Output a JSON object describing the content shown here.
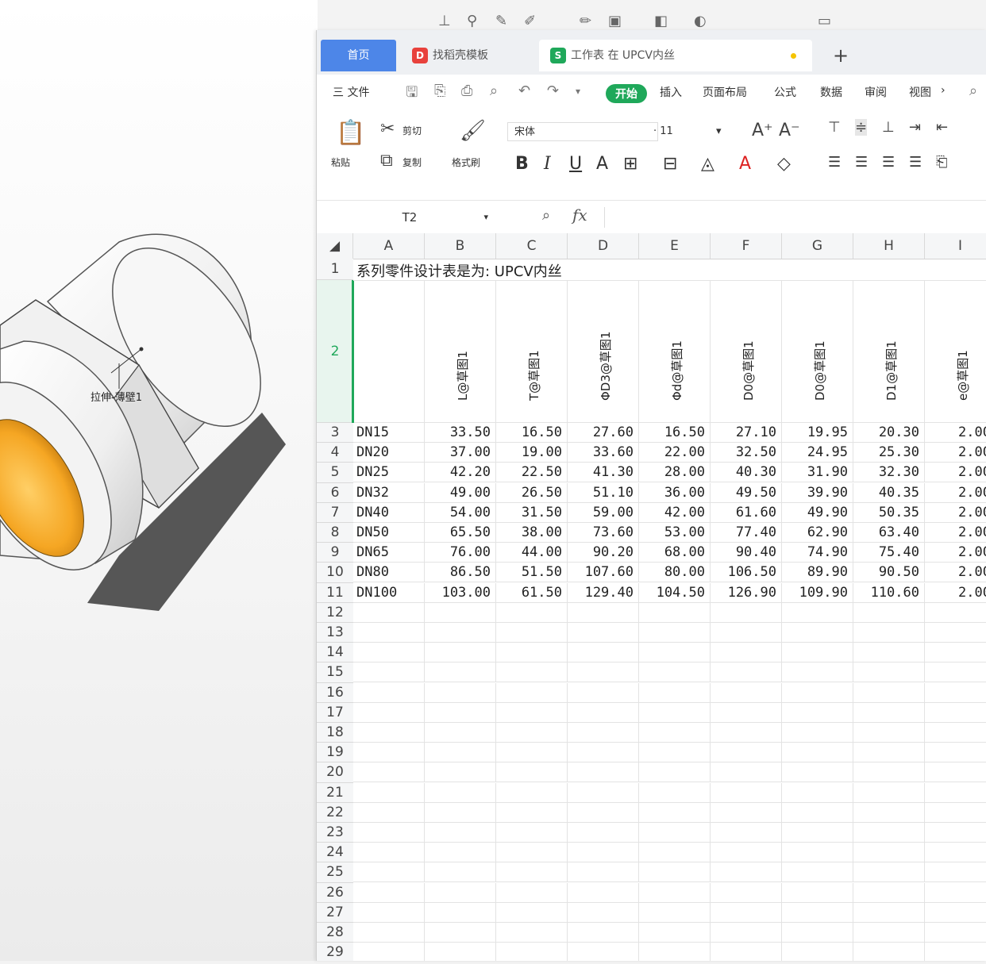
{
  "excel": {
    "tabs": [
      {
        "label": "首页"
      },
      {
        "label": "找稻壳模板"
      },
      {
        "label": "工作表 在 UPCV内丝"
      }
    ],
    "tab_add": "+",
    "menu": {
      "file": "三 文件",
      "start": "开始",
      "insert": "插入",
      "page_layout": "页面布局",
      "formula": "公式",
      "data": "数据",
      "review": "审阅",
      "view": "视图"
    },
    "ribbon": {
      "paste": "粘贴",
      "cut": "剪切",
      "copy": "复制",
      "format_painter": "格式刷",
      "font_name": "宋体",
      "font_size": "11"
    },
    "formula_bar": {
      "name_box": "T2",
      "fx": "fx",
      "value": ""
    },
    "columns": [
      "A",
      "B",
      "C",
      "D",
      "E",
      "F",
      "G",
      "H",
      "I"
    ],
    "title": "系列零件设计表是为:  UPCV内丝",
    "headers": [
      "L@草图1",
      "T@草图1",
      "ΦD3@草图1",
      "Φd@草图1",
      "D0@草图1",
      "D0@草图1",
      "D1@草图1",
      "e@草图1"
    ],
    "rows": [
      [
        "DN15",
        "33.50",
        "16.50",
        "27.60",
        "16.50",
        "27.10",
        "19.95",
        "20.30",
        "2.00"
      ],
      [
        "DN20",
        "37.00",
        "19.00",
        "33.60",
        "22.00",
        "32.50",
        "24.95",
        "25.30",
        "2.00"
      ],
      [
        "DN25",
        "42.20",
        "22.50",
        "41.30",
        "28.00",
        "40.30",
        "31.90",
        "32.30",
        "2.00"
      ],
      [
        "DN32",
        "49.00",
        "26.50",
        "51.10",
        "36.00",
        "49.50",
        "39.90",
        "40.35",
        "2.00"
      ],
      [
        "DN40",
        "54.00",
        "31.50",
        "59.00",
        "42.00",
        "61.60",
        "49.90",
        "50.35",
        "2.00"
      ],
      [
        "DN50",
        "65.50",
        "38.00",
        "73.60",
        "53.00",
        "77.40",
        "62.90",
        "63.40",
        "2.00"
      ],
      [
        "DN65",
        "76.00",
        "44.00",
        "90.20",
        "68.00",
        "90.40",
        "74.90",
        "75.40",
        "2.00"
      ],
      [
        "DN80",
        "86.50",
        "51.50",
        "107.60",
        "80.00",
        "106.50",
        "89.90",
        "90.50",
        "2.00"
      ],
      [
        "DN100",
        "103.00",
        "61.50",
        "129.40",
        "104.50",
        "126.90",
        "109.90",
        "110.60",
        "2.00"
      ]
    ],
    "row_numbers": [
      "1",
      "2",
      "3",
      "4",
      "5",
      "6",
      "7",
      "8",
      "9",
      "10",
      "11",
      "12",
      "13",
      "14",
      "15",
      "16",
      "17",
      "18",
      "19",
      "20",
      "21",
      "22",
      "23",
      "24",
      "25",
      "26",
      "27",
      "28",
      "29"
    ]
  },
  "cad": {
    "annotation": "拉伸-薄壁1"
  },
  "colors": {
    "accent_green": "#1fa85a",
    "tab_blue": "#4d86e8",
    "pipe_orange": "#f5a623"
  }
}
